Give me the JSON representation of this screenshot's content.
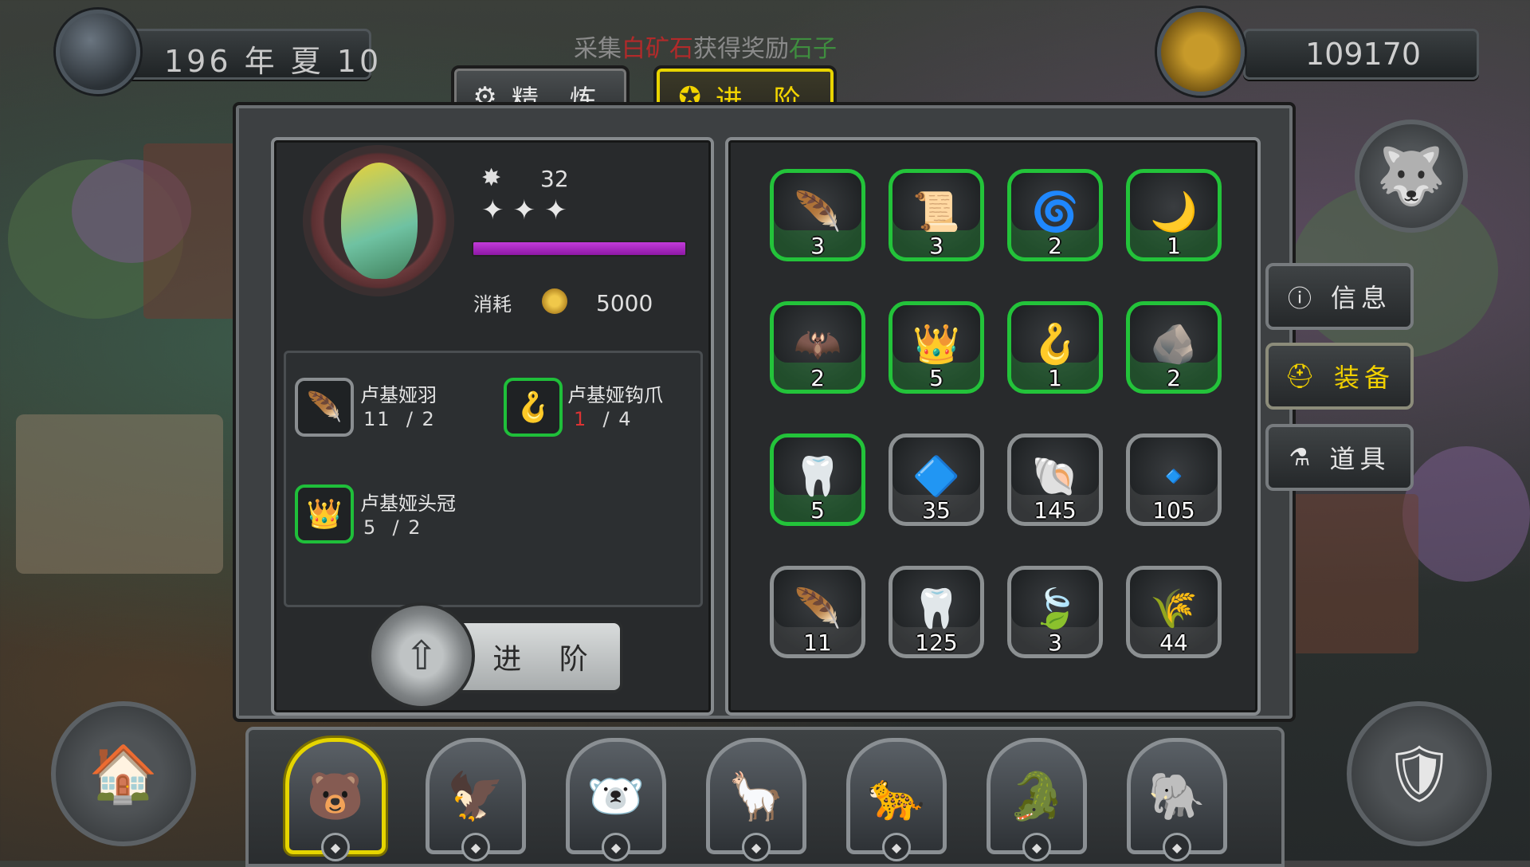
{
  "header": {
    "date": "196 年 夏 10",
    "gold": "109170",
    "notice_prefix": "采集",
    "notice_item": "白矿石",
    "notice_mid": "获得奖励",
    "notice_reward": "石子"
  },
  "tabs": [
    {
      "label": "精 炼",
      "icon": "refine-icon",
      "active": false
    },
    {
      "label": "进 阶",
      "icon": "advance-icon",
      "active": true
    }
  ],
  "equipment": {
    "power": "32",
    "stars": 3,
    "progress_fraction": 1.0,
    "cost_label": "消耗",
    "cost_value": "5000"
  },
  "requirements": [
    {
      "name": "卢基娅羽",
      "have": "11",
      "need": "/ 2",
      "icon": "feather-icon",
      "icon_glyph": "🪶",
      "border": "grey",
      "short": false
    },
    {
      "name": "卢基娅钩爪",
      "have": "1",
      "need": "/ 4",
      "icon": "hook-claw-icon",
      "icon_glyph": "🪝",
      "border": "green",
      "short": true
    },
    {
      "name": "卢基娅头冠",
      "have": "5",
      "need": "/ 2",
      "icon": "crown-icon",
      "icon_glyph": "👑",
      "border": "green",
      "short": false
    }
  ],
  "advance_button": "进 阶",
  "inventory": [
    {
      "count": "3",
      "icon": "feather-quill-icon",
      "glyph": "🪶",
      "border": "green"
    },
    {
      "count": "3",
      "icon": "scroll-icon",
      "glyph": "📜",
      "border": "green"
    },
    {
      "count": "2",
      "icon": "spiral-icon",
      "glyph": "🌀",
      "border": "green"
    },
    {
      "count": "1",
      "icon": "crescent-icon",
      "glyph": "🌙",
      "border": "green"
    },
    {
      "count": "2",
      "icon": "dark-claw-icon",
      "glyph": "🦇",
      "border": "green"
    },
    {
      "count": "5",
      "icon": "red-crown-icon",
      "glyph": "👑",
      "border": "green"
    },
    {
      "count": "1",
      "icon": "golden-hook-icon",
      "glyph": "🪝",
      "border": "green"
    },
    {
      "count": "2",
      "icon": "pink-stone-icon",
      "glyph": "🪨",
      "border": "green"
    },
    {
      "count": "5",
      "icon": "dark-fang-icon",
      "glyph": "🦷",
      "border": "green"
    },
    {
      "count": "35",
      "icon": "blue-shard-icon",
      "glyph": "🔷",
      "border": "grey"
    },
    {
      "count": "145",
      "icon": "blue-shell-icon",
      "glyph": "🐚",
      "border": "grey"
    },
    {
      "count": "105",
      "icon": "blue-fin-icon",
      "glyph": "🔹",
      "border": "grey"
    },
    {
      "count": "11",
      "icon": "green-feather-icon",
      "glyph": "🪶",
      "border": "grey"
    },
    {
      "count": "125",
      "icon": "white-fang-icon",
      "glyph": "🦷",
      "border": "grey"
    },
    {
      "count": "3",
      "icon": "green-leaf-icon",
      "glyph": "🍃",
      "border": "grey"
    },
    {
      "count": "44",
      "icon": "grass-bundle-icon",
      "glyph": "🌾",
      "border": "grey"
    }
  ],
  "side_menu": [
    {
      "label": "信息",
      "icon": "info-icon",
      "glyph": "ℹ",
      "active": false
    },
    {
      "label": "装备",
      "icon": "helmet-icon",
      "glyph": "⛑",
      "active": true
    },
    {
      "label": "道具",
      "icon": "potion-icon",
      "glyph": "⚗",
      "active": false
    }
  ],
  "heroes": [
    {
      "name": "pirate-bear-hero",
      "glyph": "🐻",
      "selected": true
    },
    {
      "name": "eagle-hero",
      "glyph": "🦅",
      "selected": false
    },
    {
      "name": "polar-bear-hero",
      "glyph": "🐻‍❄️",
      "selected": false
    },
    {
      "name": "ostrich-hero",
      "glyph": "🦙",
      "selected": false
    },
    {
      "name": "leopard-hero",
      "glyph": "🐆",
      "selected": false
    },
    {
      "name": "crocodile-hero",
      "glyph": "🐊",
      "selected": false
    },
    {
      "name": "elephant-hero",
      "glyph": "🐘",
      "selected": false
    }
  ],
  "colors": {
    "accent_yellow": "#f2d400",
    "slot_green": "#23c33a",
    "progress_purple": "#b531cf",
    "shortage_red": "#d33333"
  }
}
